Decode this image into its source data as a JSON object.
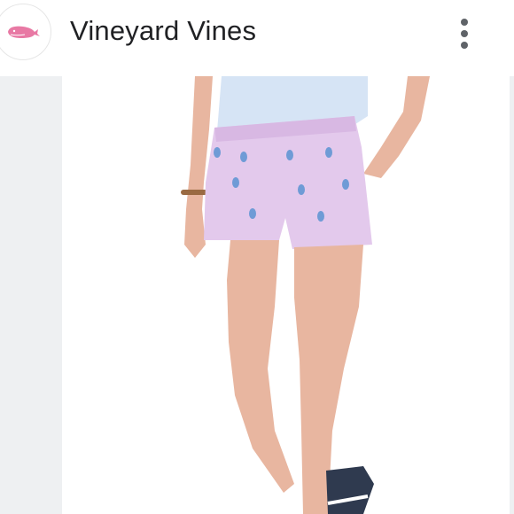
{
  "header": {
    "title": "Vineyard Vines",
    "avatar_icon": "whale-logo-icon",
    "menu_icon": "more-vert-icon"
  },
  "product_image": {
    "subject": "pink-shorts-with-pineapple-embroidery",
    "colors": {
      "shorts": "#e3c9ec",
      "embroidery": "#6f9bd6",
      "shirt": "#d6e4f5",
      "skin": "#e8b6a0",
      "shoe": "#2f3a4f"
    }
  },
  "colors": {
    "accent_logo": "#e879a4",
    "background": "#ffffff",
    "gutter": "#eef0f2",
    "title_text": "#202124"
  }
}
